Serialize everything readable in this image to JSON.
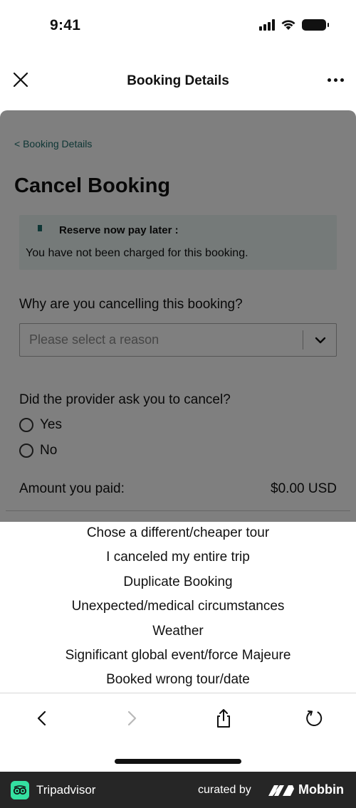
{
  "status_bar": {
    "time": "9:41"
  },
  "nav": {
    "title": "Booking Details"
  },
  "page": {
    "back_link": "< Booking Details",
    "title": "Cancel Booking",
    "notice": {
      "title": "Reserve now pay later :",
      "text": "You have not been charged for this booking."
    },
    "reason": {
      "label": "Why are you cancelling this booking?",
      "placeholder": "Please select a reason"
    },
    "provider": {
      "label": "Did the provider ask you to cancel?",
      "options": [
        "Yes",
        "No"
      ]
    },
    "amount": {
      "label": "Amount you paid:",
      "value": "$0.00 USD"
    }
  },
  "picker": {
    "options": [
      "Chose a different/cheaper tour",
      "I canceled my entire trip",
      "Duplicate Booking",
      "Unexpected/medical circumstances",
      "Weather",
      "Significant global event/force Majeure",
      "Booked wrong tour/date"
    ]
  },
  "footer": {
    "brand": "Tripadvisor",
    "curated_label": "curated by",
    "curator": "Mobbin"
  },
  "colors": {
    "accent": "#1d6d6b",
    "notice_bg": "#eaf5f3",
    "tripadvisor": "#34e0a1",
    "footer_bg": "#262626"
  }
}
